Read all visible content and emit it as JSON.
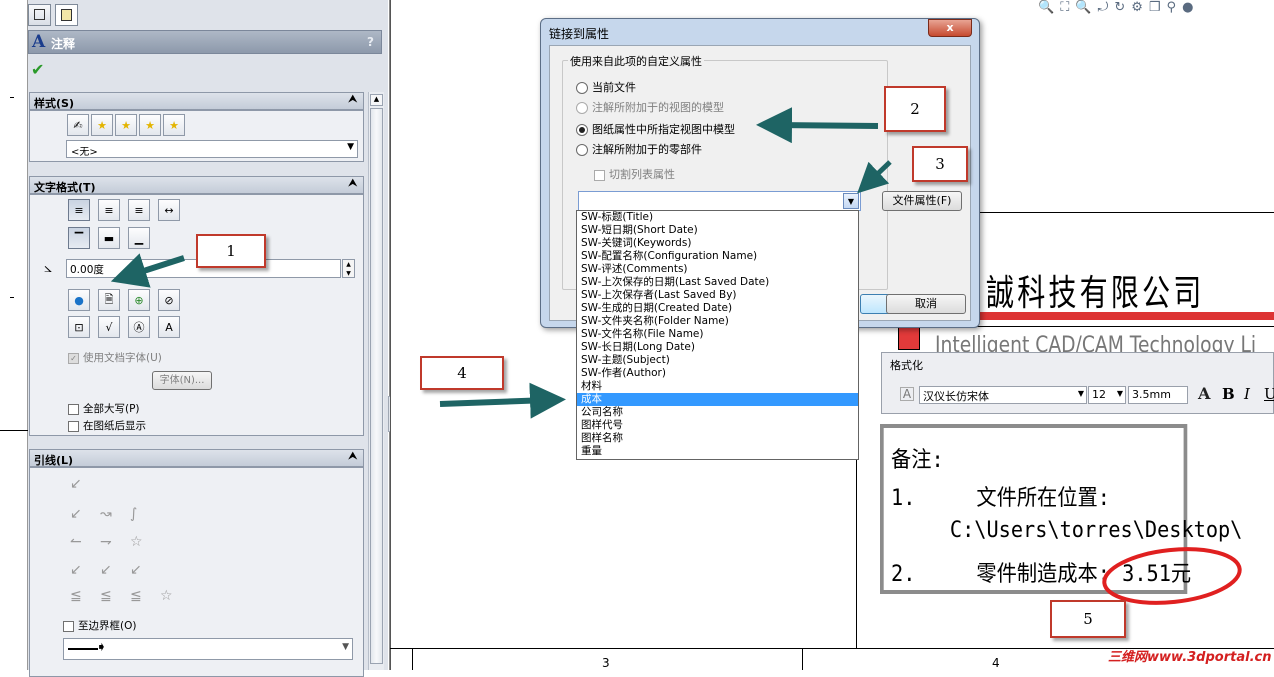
{
  "left_panel": {
    "tabs": [
      "feature-tree",
      "property-manager"
    ],
    "title": "注释",
    "help": "?",
    "ok_icon": "check-icon",
    "style_section": {
      "header": "样式(S)",
      "dropdown_value": "<无>"
    },
    "text_format_section": {
      "header": "文字格式(T)",
      "angle_value": "0.00度",
      "use_doc_font": "使用文档字体(U)",
      "font_button": "字体(N)...",
      "all_caps": "全部大写(P)",
      "behind_sheet": "在图纸后显示"
    },
    "leader_section": {
      "header": "引线(L)",
      "to_border": "至边界框(O)"
    }
  },
  "callouts": {
    "c1": "1",
    "c2": "2",
    "c3": "3",
    "c4": "4",
    "c5": "5"
  },
  "dialog": {
    "title": "链接到属性",
    "close": "x",
    "group_label": "使用来自此项的自定义属性",
    "options": [
      "当前文件",
      "注解所附加于的视图的模型",
      "图纸属性中所指定视图中模型",
      "注解所附加于的零部件"
    ],
    "selected_option": 2,
    "cut_list": "切割列表属性",
    "file_props_button": "文件属性(F)",
    "cancel_button": "取消"
  },
  "dropdown_items": [
    "SW-标题(Title)",
    "SW-短日期(Short Date)",
    "SW-关键词(Keywords)",
    "SW-配置名称(Configuration Name)",
    "SW-评述(Comments)",
    "SW-上次保存的日期(Last Saved Date)",
    "SW-上次保存者(Last Saved By)",
    "SW-生成的日期(Created Date)",
    "SW-文件夹名称(Folder Name)",
    "SW-文件名称(File Name)",
    "SW-长日期(Long Date)",
    "SW-主题(Subject)",
    "SW-作者(Author)",
    "材料",
    "成本",
    "公司名称",
    "图样代号",
    "图样名称",
    "重量"
  ],
  "dropdown_selected": 14,
  "drawing": {
    "company": "誠科技有限公司",
    "company_en": "Intelligent CAD/CAM Technology Li",
    "zone_labels": [
      "3",
      "4"
    ],
    "watermark": "三维网www.3dportal.cn"
  },
  "format_bar": {
    "title": "格式化",
    "font": "汉仪长仿宋体",
    "size": "12",
    "height": "3.5mm",
    "bold": "B",
    "italic": "I",
    "underline": "U",
    "color_btn": "A"
  },
  "notes": {
    "line1": "备注:",
    "line2": "1.     文件所在位置:",
    "line3": "C:\\Users\\torres\\Desktop\\",
    "line4": "2.     零件制造成本: 3.51元"
  },
  "colors": {
    "arrow": "#1e6464",
    "callout_border": "#c0392b",
    "ellipse": "#e02020",
    "selection": "#3399ff"
  }
}
